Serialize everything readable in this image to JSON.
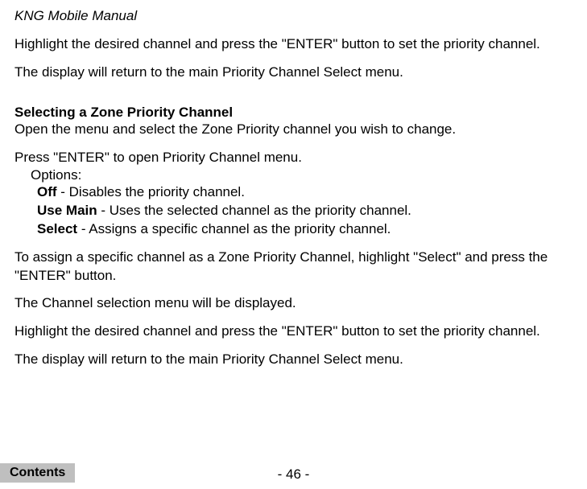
{
  "header": {
    "title": "KNG Mobile Manual"
  },
  "intro": {
    "p1": "Highlight the desired channel and press the \"ENTER\" button to set the priority channel.",
    "p2": "The display will return to the main Priority Channel Select menu."
  },
  "section": {
    "heading": "Selecting a Zone Priority Channel",
    "p1": "Open the menu and select the Zone Priority channel you wish to change.",
    "p2": "Press \"ENTER\" to open Priority Channel menu.",
    "options_label": "Options:",
    "options": [
      {
        "name": "Off",
        "desc": " - Disables the priority channel."
      },
      {
        "name": "Use Main",
        "desc": " - Uses the selected channel as the priority channel."
      },
      {
        "name": "Select",
        "desc": " - Assigns a specific channel as the priority channel."
      }
    ],
    "p3": "To assign a specific channel as a Zone Priority Channel, highlight \"Select\" and press the \"ENTER\" button.",
    "p4": "The Channel selection menu will be displayed.",
    "p5": "Highlight the desired channel and press the \"ENTER\" button to set the priority channel.",
    "p6": "The display will return to the main Priority Channel Select menu."
  },
  "footer": {
    "page": "- 46 -",
    "contents": "Contents"
  }
}
